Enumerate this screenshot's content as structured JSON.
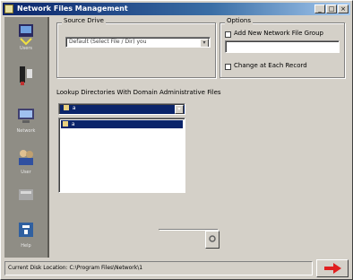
{
  "window": {
    "title": "Network Files Management",
    "controls": {
      "minimize": "_",
      "maximize": "□",
      "close": "×"
    }
  },
  "sidebar": {
    "items": [
      {
        "icon": "connect-network-icon",
        "label": "Users"
      },
      {
        "icon": "tools-icon",
        "label": ""
      },
      {
        "icon": "computer-icon",
        "label": "Network"
      },
      {
        "icon": "people-icon",
        "label": "User"
      },
      {
        "icon": "disk-icon",
        "label": ""
      },
      {
        "icon": "help-icon",
        "label": "Help"
      }
    ]
  },
  "source_group": {
    "label": "Source Drive",
    "combo_value": "Default (Select File / Dir) you",
    "combo_button": "▾"
  },
  "options_group": {
    "label": "Options",
    "add_user_label": "Add New Network File Group",
    "change_label": "Change at Each Record"
  },
  "list_section": {
    "label": "Lookup Directories With Domain Administrative Files",
    "combo_value": "a",
    "combo_button": "▾",
    "items": [
      "a"
    ]
  },
  "status": {
    "text": "Current Disk Location: C:\\Program Files\\Network\\1"
  },
  "colors": {
    "title_start": "#0a246a",
    "title_end": "#a6caf0",
    "selection": "#0a246a",
    "arrow": "#e02020",
    "sidebar": "#8f8d85"
  }
}
